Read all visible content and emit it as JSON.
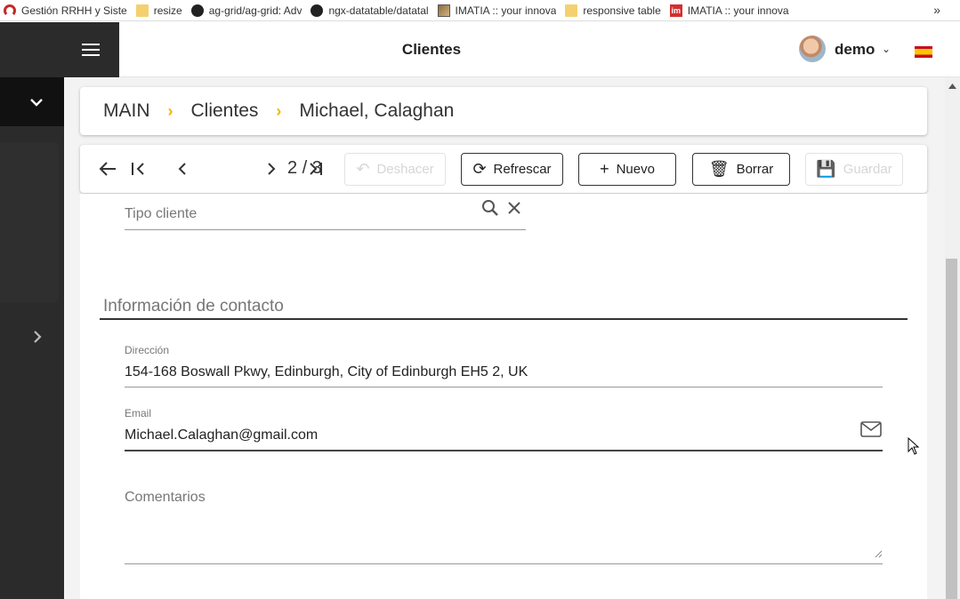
{
  "bookmarks": [
    {
      "label": "Gestión RRHH y Siste",
      "icon": "red-arc-icon"
    },
    {
      "label": "resize",
      "icon": "folder-icon"
    },
    {
      "label": "ag-grid/ag-grid: Adv",
      "icon": "github-icon"
    },
    {
      "label": "ngx-datatable/datatal",
      "icon": "github-icon"
    },
    {
      "label": "IMATIA :: your innova",
      "icon": "image-icon"
    },
    {
      "label": "responsive table",
      "icon": "folder-icon"
    },
    {
      "label": "IMATIA :: your innova",
      "icon": "im-logo-icon"
    }
  ],
  "bookmarks_more": "»",
  "header": {
    "title": "Clientes",
    "user": "demo",
    "user_chevron": "⌄"
  },
  "breadcrumb": {
    "items": [
      "MAIN",
      "Clientes",
      "Michael, Calaghan"
    ],
    "separator": "›"
  },
  "toolbar": {
    "page_indicator": "2 / 3",
    "buttons": {
      "undo": "Deshacer",
      "refresh": "Refrescar",
      "new": "Nuevo",
      "delete": "Borrar",
      "save": "Guardar"
    }
  },
  "form": {
    "tipo_cliente_placeholder": "Tipo cliente",
    "section_title": "Información de contacto",
    "direccion_label": "Dirección",
    "direccion_value": "154-168 Boswall Pkwy, Edinburgh, City of Edinburgh EH5 2, UK",
    "email_label": "Email",
    "email_value": "Michael.Calaghan@gmail.com",
    "comentarios_placeholder": "Comentarios"
  },
  "colors": {
    "accent": "#f0b400",
    "sidebar": "#2b2b2b"
  }
}
